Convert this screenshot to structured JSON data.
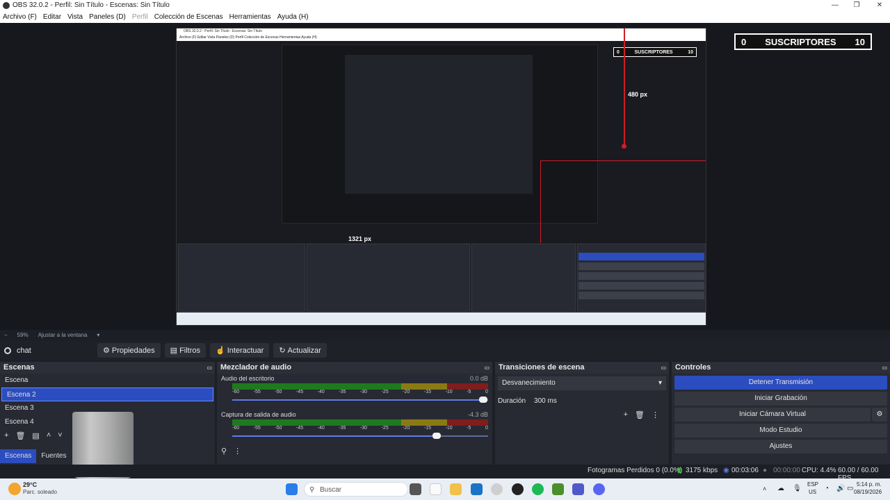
{
  "window": {
    "title": "OBS 32.0.2 - Perfil: Sin Título - Escenas: Sin Título",
    "minimize": "—",
    "maximize": "❐",
    "close": "✕"
  },
  "menu": {
    "items": [
      "Archivo (F)",
      "Editar",
      "Vista",
      "Paneles (D)",
      "Perfil",
      "Colección de Escenas",
      "Herramientas",
      "Ayuda (H)"
    ]
  },
  "preview": {
    "subscribers_big": {
      "left": "0",
      "label": "SUSCRIPTORES",
      "right": "10"
    },
    "subscribers_small": {
      "left": "0",
      "label": "SUSCRIPTORES",
      "right": "10"
    },
    "height_label": "480 px",
    "width_label": "1321 px",
    "mini_title": "OBS 32.0.2 - Perfil: Sin Título - Escenas: Sin Título",
    "mini_menu": "Archivo (F)   Editar   Vista   Paneles (D)   Perfil   Colección de Escenas   Herramientas   Ayuda (H)"
  },
  "zoom": {
    "minus": "−",
    "level": "59%",
    "fit": "Ajustar a la ventana"
  },
  "source_toolbar": {
    "source_name": "chat",
    "properties": "Propiedades",
    "filters": "Filtros",
    "interact": "Interactuar",
    "refresh": "Actualizar"
  },
  "scenes": {
    "title": "Escenas",
    "items": [
      "Escena",
      "Escena 2",
      "Escena 3",
      "Escena 4"
    ],
    "selected": "Escena 2",
    "tab_scenes": "Escenas",
    "tab_sources": "Fuentes"
  },
  "mixer": {
    "title": "Mezclador de audio",
    "ticks": [
      "-60",
      "-55",
      "-50",
      "-45",
      "-40",
      "-35",
      "-30",
      "-25",
      "-20",
      "-15",
      "-10",
      "-5",
      "0"
    ],
    "channels": [
      {
        "name": "Audio del escritorio",
        "db": "0.0 dB",
        "volume": 1.0
      },
      {
        "name": "Captura de salida de audio",
        "db": "-4.3 dB",
        "volume": 0.8
      }
    ]
  },
  "transitions": {
    "title": "Transiciones de escena",
    "selected": "Desvanecimiento",
    "duration_label": "Duración",
    "duration_value": "300 ms"
  },
  "controls": {
    "title": "Controles",
    "stop_stream": "Detener Transmisión",
    "start_recording": "Iniciar Grabación",
    "start_virtual_cam": "Iniciar Cámara Virtual",
    "studio_mode": "Modo Estudio",
    "settings": "Ajustes"
  },
  "status": {
    "dropped_frames": "Fotogramas Perdidos 0 (0.0%)",
    "bitrate": "3175 kbps",
    "stream_time": "00:03:06",
    "rec_time": "00:00:00",
    "cpu": "CPU: 4.4%",
    "fps": "60.00 / 60.00 FPS"
  },
  "taskbar": {
    "weather_temp": "29°C",
    "weather_desc": "Parc. soleado",
    "search": "Buscar",
    "lang": "ESP",
    "region": "US",
    "time": "5:14 p. m.",
    "date": "08/19/2026"
  },
  "colors": {
    "accent": "#2c4dbf",
    "red_guides": "#d01c28"
  }
}
